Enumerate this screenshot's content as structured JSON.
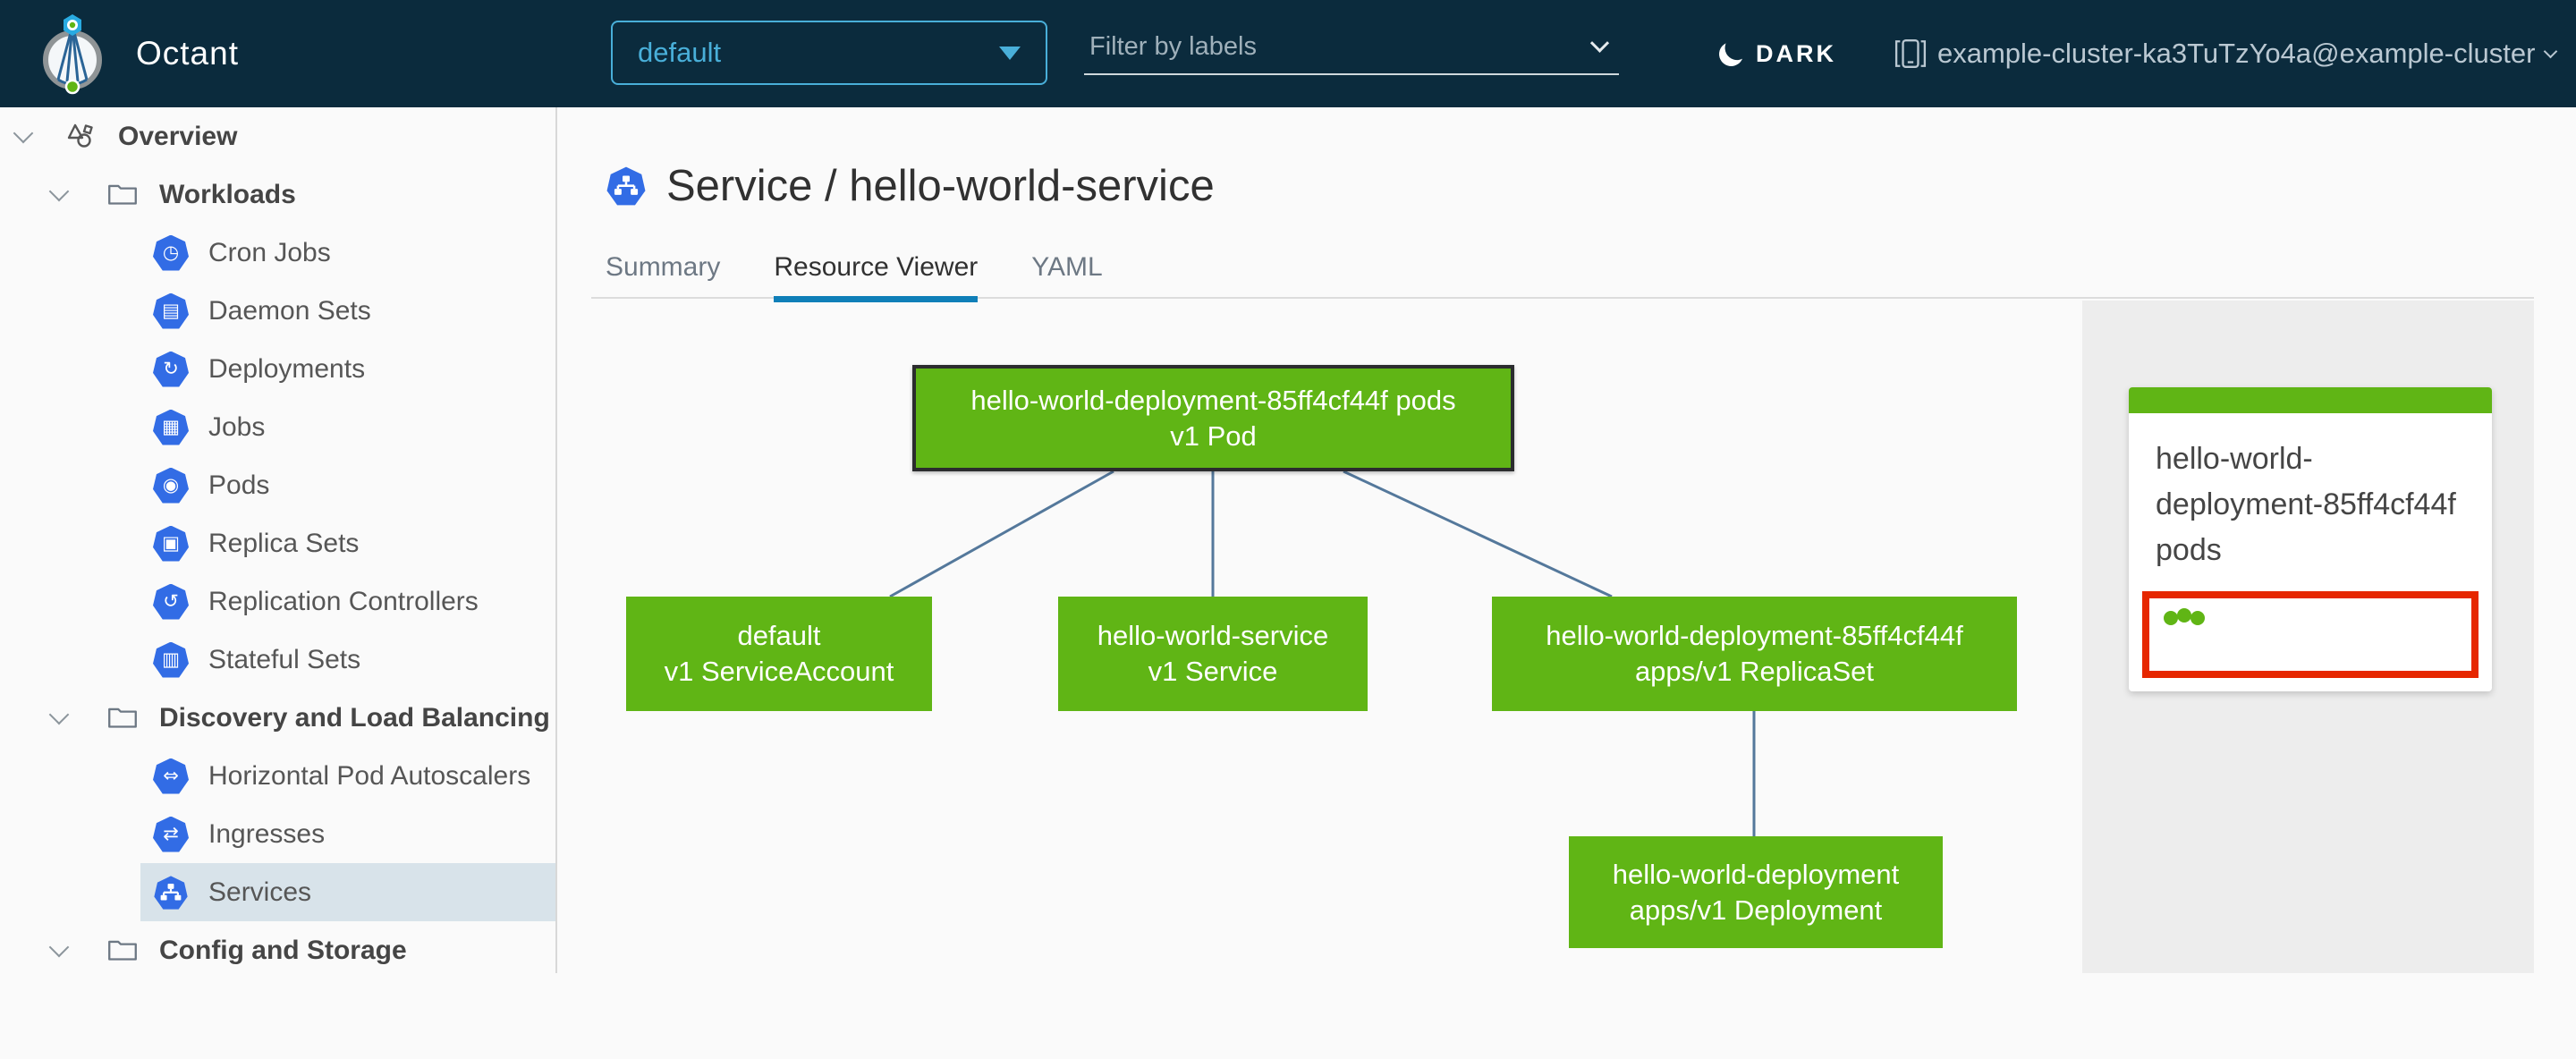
{
  "colors": {
    "header-bg": "#0b2b3d",
    "accent": "#49afd9",
    "k8s-blue": "#326ce5",
    "green": "#60b515",
    "alert-red": "#e62700",
    "edge": "#54789b",
    "tab-blue": "#0f7fb8",
    "sel-bg": "#d8e3ea"
  },
  "header": {
    "app_title": "Octant",
    "namespace_selector": {
      "value": "default"
    },
    "filter": {
      "placeholder": "Filter by labels"
    },
    "theme_toggle": {
      "label": "DARK"
    },
    "cluster_selector": {
      "label": "example-cluster-ka3TuTzYo4a@example-cluster"
    }
  },
  "sidebar": {
    "items": [
      {
        "label": "Overview",
        "level": 0,
        "icon": "overview",
        "chevron": true,
        "group": true
      },
      {
        "label": "Workloads",
        "level": 1,
        "icon": "folder",
        "chevron": true,
        "group": true
      },
      {
        "label": "Cron Jobs",
        "level": 2,
        "icon": "cronjob"
      },
      {
        "label": "Daemon Sets",
        "level": 2,
        "icon": "daemonset"
      },
      {
        "label": "Deployments",
        "level": 2,
        "icon": "deployment"
      },
      {
        "label": "Jobs",
        "level": 2,
        "icon": "job"
      },
      {
        "label": "Pods",
        "level": 2,
        "icon": "pod"
      },
      {
        "label": "Replica Sets",
        "level": 2,
        "icon": "replicaset"
      },
      {
        "label": "Replication Controllers",
        "level": 2,
        "icon": "replicationcontroller"
      },
      {
        "label": "Stateful Sets",
        "level": 2,
        "icon": "statefulset"
      },
      {
        "label": "Discovery and Load Balancing",
        "level": 1,
        "icon": "folder",
        "chevron": true,
        "group": true
      },
      {
        "label": "Horizontal Pod Autoscalers",
        "level": 2,
        "icon": "hpa"
      },
      {
        "label": "Ingresses",
        "level": 2,
        "icon": "ingress"
      },
      {
        "label": "Services",
        "level": 2,
        "icon": "service",
        "selected": true
      },
      {
        "label": "Config and Storage",
        "level": 1,
        "icon": "folder",
        "chevron": true,
        "group": true
      }
    ]
  },
  "main": {
    "page_title": "Service / hello-world-service",
    "tabs": [
      {
        "label": "Summary",
        "active": false
      },
      {
        "label": "Resource Viewer",
        "active": true
      },
      {
        "label": "YAML",
        "active": false
      }
    ]
  },
  "graph": {
    "nodes": [
      {
        "id": "pod",
        "name": "hello-world-deployment-85ff4cf44f pods",
        "kind": "v1 Pod",
        "selected": true
      },
      {
        "id": "serviceaccount",
        "name": "default",
        "kind": "v1 ServiceAccount",
        "selected": false
      },
      {
        "id": "service",
        "name": "hello-world-service",
        "kind": "v1 Service",
        "selected": false
      },
      {
        "id": "replicaset",
        "name": "hello-world-deployment-85ff4cf44f",
        "kind": "apps/v1 ReplicaSet",
        "selected": false
      },
      {
        "id": "deployment",
        "name": "hello-world-deployment",
        "kind": "apps/v1 Deployment",
        "selected": false
      }
    ]
  },
  "detail_panel": {
    "card_title": "hello-world-deployment-85ff4cf44f pods",
    "pod_status": {
      "ok_count": 3
    }
  }
}
